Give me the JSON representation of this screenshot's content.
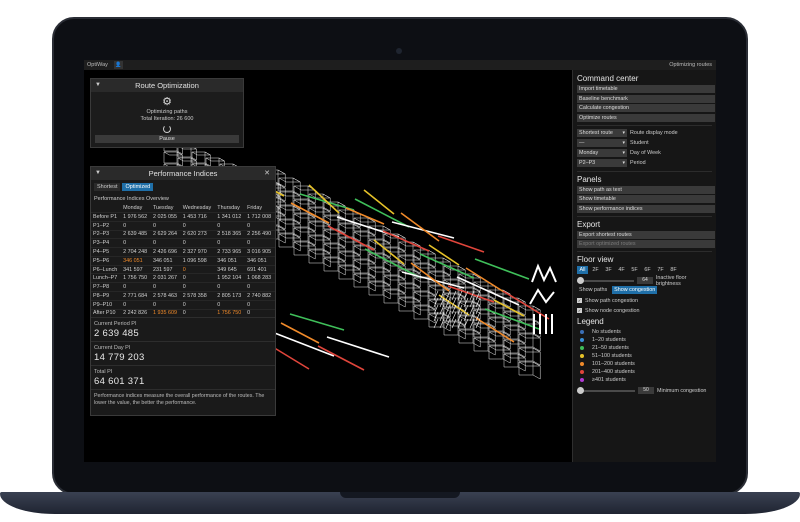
{
  "app": {
    "name": "OptiWay",
    "status": "Optimizing routes",
    "user_icon": "user-icon"
  },
  "route_panel": {
    "title": "Route Optimization",
    "icon": "gear-icon",
    "status": "Optimizing paths",
    "iteration": "Total Iteration: 26 600",
    "pause_label": "Pause"
  },
  "perf_panel": {
    "title": "Performance Indices",
    "tabs": [
      "Shortest",
      "Optimized"
    ],
    "active_tab": "Optimized",
    "overview_title": "Performance Indices Overview",
    "columns": [
      "",
      "Monday",
      "Tuesday",
      "Wednesday",
      "Thursday",
      "Friday"
    ],
    "rows": [
      [
        "Before P1",
        "1 976 562",
        "2 025 055",
        "1 453 716",
        "1 341 012",
        "1 712 008"
      ],
      [
        "P1–P2",
        "0",
        "0",
        "0",
        "0",
        "0"
      ],
      [
        "P2–P3",
        "2 639 485",
        "2 629 264",
        "2 620 273",
        "2 518 365",
        "2 256 490"
      ],
      [
        "P3–P4",
        "0",
        "0",
        "0",
        "0",
        "0"
      ],
      [
        "P4–P5",
        "2 704 248",
        "2 426 696",
        "2 327 970",
        "2 733 965",
        "3 016 905"
      ],
      [
        "P5–P6",
        "346 051",
        "346 051",
        "1 096 598",
        "346 051",
        "346 051"
      ],
      [
        "P6–Lunch",
        "341 597",
        "231 597",
        "0",
        "349 645",
        "691 401"
      ],
      [
        "Lunch–P7",
        "1 756 750",
        "2 031 267",
        "0",
        "1 952 104",
        "1 068 283"
      ],
      [
        "P7–P8",
        "0",
        "0",
        "0",
        "0",
        "0"
      ],
      [
        "P8–P9",
        "2 771 684",
        "2 578 463",
        "2 578 358",
        "2 805 173",
        "2 740 882"
      ],
      [
        "P9–P10",
        "0",
        "0",
        "0",
        "0",
        "0"
      ],
      [
        "After P10",
        "2 242 826",
        "1 935 609",
        "0",
        "1 756 750",
        "0"
      ]
    ],
    "highlights": [
      [
        5,
        1
      ],
      [
        6,
        3
      ],
      [
        11,
        2
      ],
      [
        11,
        4
      ]
    ],
    "current_period_label": "Current Period PI",
    "current_period_value": "2 639 485",
    "current_day_label": "Current Day PI",
    "current_day_value": "14 779 203",
    "total_label": "Total PI",
    "total_value": "64 601 371",
    "note": "Performance indices measure the overall performance of the routes. The lower the value, the better the performance."
  },
  "sidebar": {
    "command_title": "Command center",
    "commands": [
      "Import timetable",
      "Baseline benchmark",
      "Calculate congestion",
      "Optimize routes"
    ],
    "selects": [
      {
        "value": "Shortest route",
        "label": "Route display mode"
      },
      {
        "value": "—",
        "label": "Student"
      },
      {
        "value": "Monday",
        "label": "Day of Week"
      },
      {
        "value": "P2–P3",
        "label": "Period"
      }
    ],
    "panels_title": "Panels",
    "panels": [
      "Show path as text",
      "Show timetable",
      "Show performance indices"
    ],
    "export_title": "Export",
    "exports": [
      "Export shortest routes",
      "Export optimized routes"
    ],
    "floor_title": "Floor view",
    "floors": [
      "All",
      "2F",
      "3F",
      "4F",
      "5F",
      "6F",
      "7F",
      "8F"
    ],
    "active_floor": "All",
    "inactive_brightness_value": "64",
    "inactive_brightness_label": "Inactive floor brightness",
    "view_toggles": [
      "Show paths",
      "Show congestion"
    ],
    "active_view_toggle": "Show congestion",
    "checks": [
      "Show path congestion",
      "Show node congestion"
    ],
    "legend_title": "Legend",
    "legend": [
      {
        "label": "No students",
        "color": "#3b6fb6"
      },
      {
        "label": "1–20 students",
        "color": "#3a8fd6"
      },
      {
        "label": "21–50 students",
        "color": "#3fbf5a"
      },
      {
        "label": "51–100 students",
        "color": "#e6c229"
      },
      {
        "label": "101–200 students",
        "color": "#f08a2a"
      },
      {
        "label": "201–400 students",
        "color": "#e0453b"
      },
      {
        "label": "≥401 students",
        "color": "#b23ad6"
      }
    ],
    "min_congestion_value": "50",
    "min_congestion_label": "Minimum congestion"
  }
}
